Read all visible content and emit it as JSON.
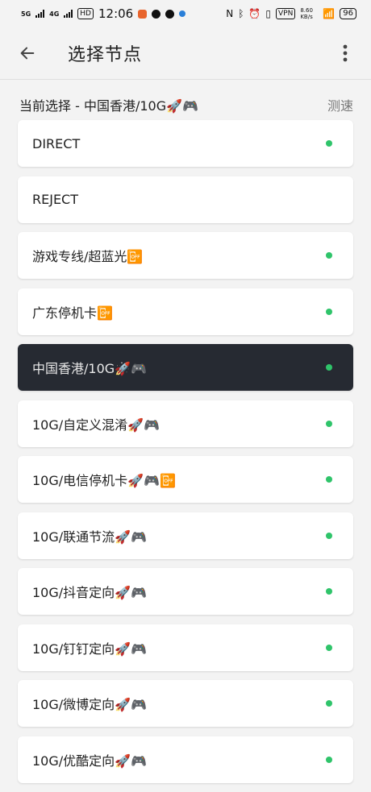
{
  "status_bar": {
    "net1": "5G",
    "net2": "4G",
    "hd": "HD",
    "time": "12:06",
    "vpn": "VPN",
    "speed": "8.60 KB/s",
    "battery": "96"
  },
  "app_bar": {
    "title": "选择节点"
  },
  "current": {
    "label": "当前选择 - 中国香港/10G🚀🎮",
    "speedtest": "测速"
  },
  "nodes": [
    {
      "label": "DIRECT",
      "selected": false,
      "has_dot": true
    },
    {
      "label": "REJECT",
      "selected": false,
      "has_dot": false
    },
    {
      "label": "游戏专线/超蓝光📴",
      "selected": false,
      "has_dot": true
    },
    {
      "label": "广东停机卡📴",
      "selected": false,
      "has_dot": true
    },
    {
      "label": "中国香港/10G🚀🎮",
      "selected": true,
      "has_dot": true
    },
    {
      "label": "10G/自定义混淆🚀🎮",
      "selected": false,
      "has_dot": true
    },
    {
      "label": "10G/电信停机卡🚀🎮📴",
      "selected": false,
      "has_dot": true
    },
    {
      "label": "10G/联通节流🚀🎮",
      "selected": false,
      "has_dot": true
    },
    {
      "label": "10G/抖音定向🚀🎮",
      "selected": false,
      "has_dot": true
    },
    {
      "label": "10G/钉钉定向🚀🎮",
      "selected": false,
      "has_dot": true
    },
    {
      "label": "10G/微博定向🚀🎮",
      "selected": false,
      "has_dot": true
    },
    {
      "label": "10G/优酷定向🚀🎮",
      "selected": false,
      "has_dot": true
    }
  ],
  "colors": {
    "background": "#f3f3f3",
    "selected_bg": "#262a32",
    "dot_green": "#2fc46a"
  }
}
